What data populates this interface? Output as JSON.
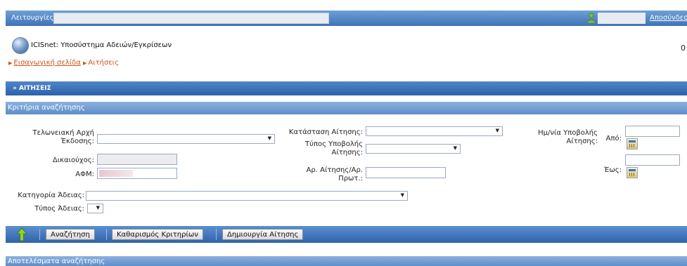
{
  "topbar": {
    "menu_label": "Λειτουργίες",
    "logout_label": "Αποσύνδεση"
  },
  "app": {
    "title": "ICISnet: Υποσύστημα Αδειών/Εγκρίσεων",
    "right_char": "0"
  },
  "breadcrumb": {
    "home": "Εισαγωγική σελίδα",
    "current": "Αιτήσεις"
  },
  "section": {
    "title": "» ΑΙΤΗΣΕΙΣ"
  },
  "criteria": {
    "title": "Κριτήρια αναζήτησης",
    "customs_office_label_1": "Τελωνειακή Αρχή",
    "customs_office_label_2": "Έκδοσης:",
    "beneficiary_label": "Δικαιούχος:",
    "afm_label": "ΑΦΜ:",
    "status_label": "Κατάσταση Αίτησης:",
    "submission_type_label_1": "Τύπος Υποβολής",
    "submission_type_label_2": "Αίτησης:",
    "application_no_label_1": "Αρ. Αίτησης/Αρ.",
    "application_no_label_2": "Πρωτ.:",
    "submission_date_label_1": "Ημ/νία Υποβολής",
    "submission_date_label_2": "Αίτησης:",
    "from_label": "Από:",
    "to_label": "Έως:",
    "category_label": "Κατηγορία Άδειας:",
    "license_type_label": "Τύπος Άδειας:"
  },
  "toolbar": {
    "search": "Αναζήτηση",
    "clear": "Καθαρισμός Κριτηρίων",
    "create": "Δημιουργία Αίτησης"
  },
  "results": {
    "title": "Αποτελέσματα αναζήτησης"
  },
  "icons": {
    "dropdown": "▼",
    "breadcrumb_arrow": "▶"
  },
  "colors": {
    "header_blue": "#3f73b6",
    "link_orange": "#d0531b"
  }
}
